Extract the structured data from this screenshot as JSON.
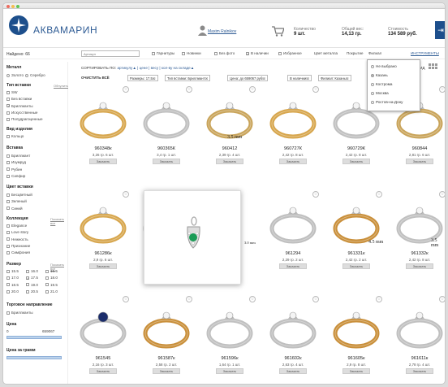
{
  "brand": {
    "name": "АКВАМАРИН"
  },
  "header": {
    "user": "Maxim Ralnikov",
    "qty_label": "Количество",
    "qty_value": "9 шт.",
    "weight_label": "Общий вес:",
    "weight_value": "14,13 гр.",
    "cost_label": "Стоимость",
    "cost_value": "134 589 руб.",
    "exit_icon": "exit-icon",
    "user_icon": "user-icon",
    "cart_icon": "cart-icon"
  },
  "filters": {
    "found": "Найдено: 66",
    "article_placeholder": "Артикул",
    "garnitury": "Гарнитуры",
    "novinki": "Новинки",
    "bez_foto": "Без фото",
    "v_nalichii": "В наличии",
    "izbrannoe": "Избранное",
    "cvet_metalla": "Цвет металла",
    "pokrytie": "Покрытие",
    "filial": "Филиал",
    "instrumenty": "ИНСТРУМЕНТЫ"
  },
  "sort": {
    "label": "СОРТИРОВАТЬ ПО:",
    "options": "артикулу▲ | цене | весу | кол-ву на складе▲",
    "clear": "ОЧИСТИТЬ ВСЁ",
    "vid": "ВИД"
  },
  "chips": [
    "Размеры: 17,5☒",
    "Тип вставки: Бриллиант☒",
    "Цена: до 659067 руб☒",
    "В наличии☒",
    "Филиал: Казань☒"
  ],
  "dropdown": {
    "items": [
      "Не выбрано",
      "Казань",
      "Кострома",
      "Москва",
      "Ростов-на-Дону"
    ],
    "selected": "Казань"
  },
  "sidebar": {
    "metal_title": "Металл",
    "metal": [
      "Золото",
      "Серебро"
    ],
    "insert_title": "Тип вставки",
    "insert_reset": "Обнулить",
    "inserts": [
      "SW",
      "Без вставки",
      "Бриллианты",
      "Искусственные",
      "Полудрагоценные"
    ],
    "kind_title": "Вид изделия",
    "kinds": [
      "Кольцо"
    ],
    "vstavka_title": "Вставка",
    "vstavki": [
      "Бриллиант",
      "Изумруд",
      "Рубин",
      "Сапфир"
    ],
    "color_title": "Цвет вставки",
    "colors": [
      "Бесцветный",
      "Зеленый",
      "Синий"
    ],
    "coll_title": "Коллекция",
    "coll_reset": "Показать все",
    "colls": [
      "Elegance",
      "Love story",
      "Нежность",
      "Признание",
      "Симфония"
    ],
    "size_title": "Размер",
    "size_reset": "Показать все",
    "sizes": [
      "15.5",
      "16.0",
      "16.5",
      "17.0",
      "17.5",
      "18.0",
      "18.5",
      "19.0",
      "19.5",
      "20.0",
      "20.5",
      "21.0"
    ],
    "trade_title": "Торговое направление",
    "trades": [
      "Бриллианты"
    ],
    "price_title": "Цена",
    "price_from": "0",
    "price_to": "659067",
    "gram_title": "Цена за грамм"
  },
  "products": [
    {
      "code": "960348к",
      "meta": "3,26 гр.   6 шт."
    },
    {
      "code": "960365К",
      "meta": "3,4 гр.   1 шт."
    },
    {
      "code": "960412",
      "meta": "2,39 гр.   4 шт."
    },
    {
      "code": "960727К",
      "meta": "2,42 гр.   8 шт."
    },
    {
      "code": "960729К",
      "meta": "2,42 гр.   8 шт."
    },
    {
      "code": "960844",
      "meta": "2,81 гр.   6 шт."
    },
    {
      "code": "961286к",
      "meta": "2,9 гр.   6 шт."
    },
    {
      "code": "",
      "meta": ""
    },
    {
      "code": "961294",
      "meta": "2,29 гр.   2 шт."
    },
    {
      "code": "961331к",
      "meta": "2,42 гр.   2 шт."
    },
    {
      "code": "961332к",
      "meta": "2,42 гр.   8 шт."
    },
    {
      "code": "961545",
      "meta": "2,16 гр.   3 шт."
    },
    {
      "code": "961587к",
      "meta": "2,58 гр.   2 шт."
    },
    {
      "code": "961596к",
      "meta": "1,64 гр.   1 шт."
    },
    {
      "code": "961602к",
      "meta": "2,63 гр.   4 шт."
    },
    {
      "code": "961605к",
      "meta": "2,9 гр.   8 шт."
    },
    {
      "code": "961611к",
      "meta": "2,78 гр.   4 шт."
    }
  ],
  "order_label": "Заказать",
  "size_marks": [
    "3.5 mm",
    "3.0 mm",
    "4.5 mm",
    "3.5 mm"
  ]
}
